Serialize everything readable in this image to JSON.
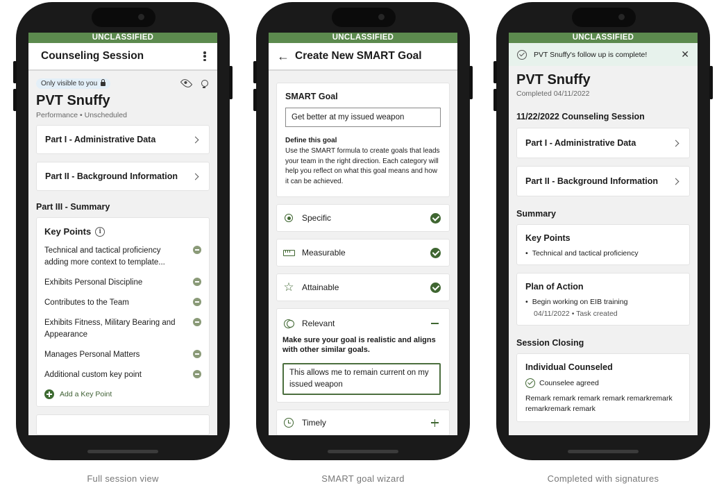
{
  "classification": "UNCLASSIFIED",
  "screen1": {
    "title": "Counseling Session",
    "visibility": "Only visible to you",
    "name": "PVT Snuffy",
    "subtitle": "Performance • Unscheduled",
    "part1": "Part I - Administrative Data",
    "part2": "Part II - Background Information",
    "part3": "Part III - Summary",
    "key_points_title": "Key Points",
    "key_points": [
      "Technical and tactical proficiency adding more context to template...",
      "Exhibits Personal Discipline",
      "Contributes to the Team",
      "Exhibits Fitness, Military Bearing and Appearance",
      "Manages Personal Matters",
      "Additional custom key point"
    ],
    "add_key_point": "Add a Key Point"
  },
  "screen2": {
    "title": "Create New SMART Goal",
    "goal_label": "SMART Goal",
    "goal_value": "Get better at my issued weapon",
    "define_title": "Define this goal",
    "define_text": "Use the SMART formula to create goals that leads your team in the right direction. Each category will help you reflect on what this goal means and how it can be achieved.",
    "criteria": [
      {
        "label": "Specific",
        "icon": "target-icon",
        "status": "complete"
      },
      {
        "label": "Measurable",
        "icon": "ruler-icon",
        "status": "complete"
      },
      {
        "label": "Attainable",
        "icon": "star-icon",
        "status": "complete"
      }
    ],
    "relevant": {
      "label": "Relevant",
      "description": "Make sure your goal is realistic and aligns with other similar goals.",
      "value": "This allows me to remain current on my issued weapon"
    },
    "timely": "Timely"
  },
  "screen3": {
    "alert": "PVT Snuffy's follow up is complete!",
    "name": "PVT Snuffy",
    "completed": "Completed 04/11/2022",
    "session_title": "11/22/2022 Counseling Session",
    "part1": "Part I - Administrative Data",
    "part2": "Part II - Background Information",
    "summary": "Summary",
    "key_points_title": "Key Points",
    "key_point": "Technical and tactical proficiency",
    "plan_title": "Plan of Action",
    "plan_item": "Begin working on EIB training",
    "plan_meta": "04/11/2022 • Task created",
    "closing": "Session Closing",
    "individual_title": "Individual Counseled",
    "agreed": "Counselee agreed",
    "remarks": "Remark remark remark remark remarkremark remarkremark remark"
  },
  "captions": [
    "Full session view",
    "SMART goal wizard",
    "Completed with signatures"
  ],
  "colors": {
    "banner": "#5c8a4e",
    "accent": "#3f6631"
  }
}
